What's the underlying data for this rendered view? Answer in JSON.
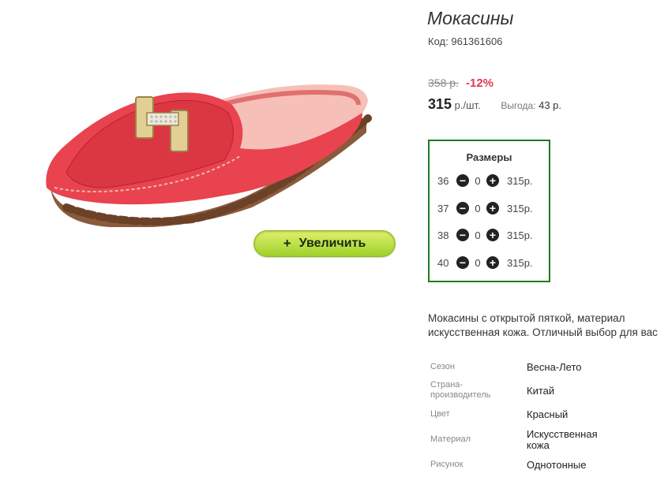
{
  "product": {
    "title": "Мокасины",
    "code_label": "Код:",
    "code": "961361606",
    "old_price": "358 р.",
    "discount": "-12%",
    "price": "315",
    "price_unit": "р./шт.",
    "benefit_label": "Выгода:",
    "benefit": "43 р.",
    "zoom_button": "Увеличить",
    "zoom_icon": "+"
  },
  "sizes": {
    "header": "Размеры",
    "rows": [
      {
        "size": "36",
        "qty": "0",
        "price": "315р."
      },
      {
        "size": "37",
        "qty": "0",
        "price": "315р."
      },
      {
        "size": "38",
        "qty": "0",
        "price": "315р."
      },
      {
        "size": "40",
        "qty": "0",
        "price": "315р."
      }
    ]
  },
  "description": "Мокасины с открытой пяткой, материал искусственная кожа. Отличный выбор для вас",
  "properties": [
    {
      "label": "Сезон",
      "value": "Весна-Лето"
    },
    {
      "label": "Страна-производитель",
      "value": "Китай"
    },
    {
      "label": "Цвет",
      "value": "Красный"
    },
    {
      "label": "Материал",
      "value": "Искусственная кожа"
    },
    {
      "label": "Рисунок",
      "value": "Однотонные"
    }
  ],
  "colors": {
    "accent_green": "#1f7a1f",
    "discount_red": "#e13a4f",
    "button_green": "#9fd12a"
  }
}
